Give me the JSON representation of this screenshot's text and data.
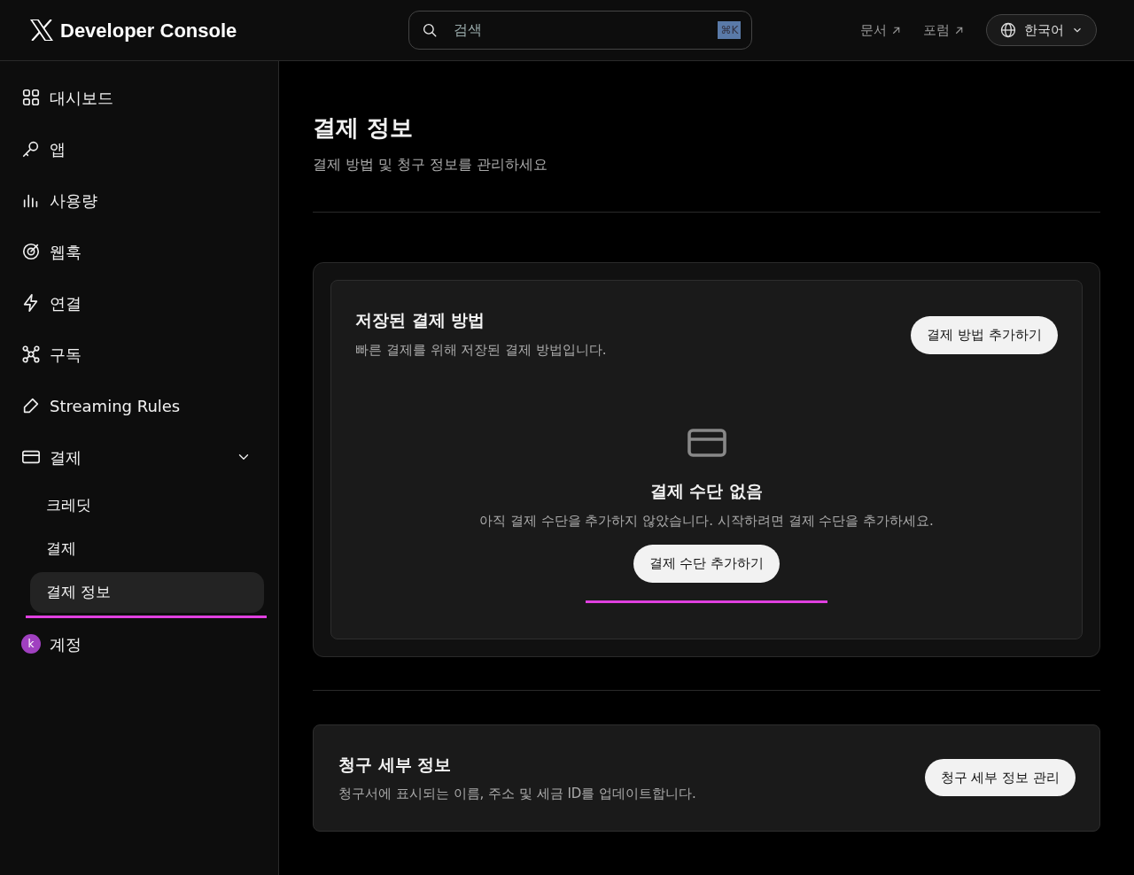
{
  "header": {
    "brand": "Developer Console",
    "search": {
      "placeholder": "검색",
      "shortcut": "⌘K"
    },
    "links": [
      {
        "label": "문서"
      },
      {
        "label": "포럼"
      }
    ],
    "language": "한국어"
  },
  "sidebar": {
    "items": [
      {
        "kind": "grid",
        "label": "대시보드",
        "selected": false
      },
      {
        "kind": "key",
        "label": "앱",
        "selected": false
      },
      {
        "kind": "chart",
        "label": "사용량",
        "selected": false
      },
      {
        "kind": "target",
        "label": "웹훅",
        "selected": false
      },
      {
        "kind": "bolt",
        "label": "연결",
        "selected": false
      },
      {
        "kind": "nodes",
        "label": "구독",
        "selected": false
      },
      {
        "kind": "pencil",
        "label": "Streaming Rules",
        "selected": false
      },
      {
        "kind": "card",
        "label": "결제",
        "selected": false,
        "expanded": true,
        "children": [
          {
            "label": "크레딧",
            "selected": false
          },
          {
            "label": "결제",
            "selected": false
          },
          {
            "label": "결제 정보",
            "selected": true,
            "underlined": true
          }
        ]
      },
      {
        "kind": "avatar",
        "label": "계정",
        "selected": false,
        "avatar": "k",
        "color": "#a040c0"
      }
    ]
  },
  "page": {
    "title": "결제 정보",
    "subtitle": "결제 방법 및 청구 정보를 관리하세요",
    "payment_methods": {
      "title": "저장된 결제 방법",
      "description": "빠른 결제를 위해 저장된 결제 방법입니다.",
      "button": "결제 방법 추가하기",
      "empty": {
        "title": "결제 수단 없음",
        "text": "아직 결제 수단을 추가하지 않았습니다. 시작하려면 결제 수단을 추가하세요.",
        "button": "결제 수단 추가하기",
        "underlined": true
      }
    },
    "billing_details": {
      "title": "청구 세부 정보",
      "description": "청구서에 표시되는 이름, 주소 및 세금 ID를 업데이트합니다.",
      "button": "청구 세부 정보 관리"
    }
  }
}
